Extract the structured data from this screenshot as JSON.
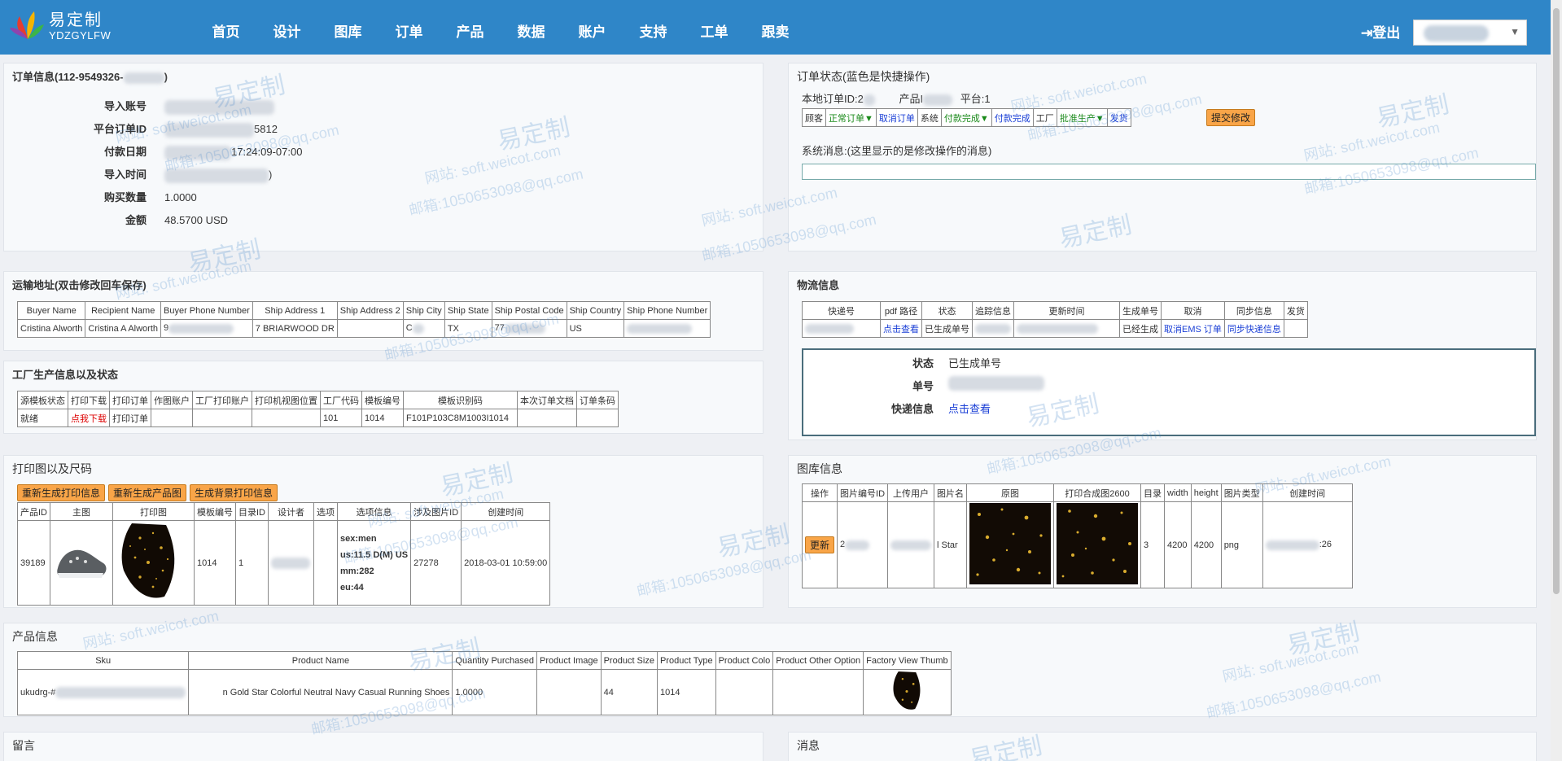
{
  "brand": {
    "name_cn": "易定制",
    "name_en": "YDZGYLFW",
    "colors": {
      "nav": "#2f86c8",
      "accent_button": "#f9a548",
      "link": "#1a3fd6"
    }
  },
  "nav": {
    "items": [
      "首页",
      "设计",
      "图库",
      "订单",
      "产品",
      "数据",
      "账户",
      "支持",
      "工单",
      "跟卖"
    ],
    "logout": "登出",
    "logout_icon": "logout-icon"
  },
  "order_info": {
    "title": "订单信息(112-9549326-",
    "title_end": ")",
    "rows": [
      {
        "k": "导入账号",
        "v": ""
      },
      {
        "k": "平台订单ID",
        "v": "5812"
      },
      {
        "k": "付款日期",
        "v": "17:24:09-07:00"
      },
      {
        "k": "导入时间",
        "v": ")"
      },
      {
        "k": "购买数量",
        "v": "1.0000"
      },
      {
        "k": "金额",
        "v": "48.5700  USD"
      }
    ]
  },
  "order_status": {
    "title": "订单状态(蓝色是快捷操作)",
    "local_id_label": "本地订单ID:2",
    "product_label": "产品I",
    "platform_label": "平台:1",
    "customer": "顾客",
    "customer_status": "正常订单▼",
    "cancel": "取消订单",
    "system": "系统",
    "pay_status": "付款完成▼",
    "pay_link": "付款完成",
    "factory": "工厂",
    "factory_status": "批准生产▼",
    "ship": "发货",
    "submit": "提交修改",
    "sys_msg": "系统消息:(这里显示的是修改操作的消息)"
  },
  "shipping": {
    "title": "运输地址(双击修改回车保存)",
    "headers": [
      "Buyer Name",
      "Recipient Name",
      "Buyer Phone Number",
      "Ship Address 1",
      "Ship Address 2",
      "Ship City",
      "Ship State",
      "Ship Postal Code",
      "Ship Country",
      "Ship Phone Number"
    ],
    "row": [
      "Cristina Alworth",
      "Cristina A Alworth",
      "9",
      "7 BRIARWOOD DR",
      "",
      "C",
      "TX",
      "77",
      "US",
      ""
    ]
  },
  "logistics": {
    "title": "物流信息",
    "headers": [
      "快递号",
      "pdf 路径",
      "状态",
      "追踪信息",
      "更新时间",
      "生成单号",
      "取消",
      "同步信息",
      "发货"
    ],
    "row": [
      "",
      "点击查看",
      "已生成单号",
      "",
      "",
      "已经生成",
      "取消EMS 订单",
      "同步快递信息",
      ""
    ],
    "status_label": "状态",
    "status_value": "已生成单号",
    "number_label": "单号",
    "express_label": "快递信息",
    "express_link": "点击查看"
  },
  "factory": {
    "title": "工厂生产信息以及状态",
    "headers": [
      "源模板状态",
      "打印下载",
      "打印订单",
      "作图账户",
      "工厂打印账户",
      "打印机视图位置",
      "工厂代码",
      "模板编号",
      "模板识别码",
      "本次订单文档",
      "订单条码"
    ],
    "row": [
      "就绪",
      "点我下载",
      "打印订单",
      "",
      "",
      "",
      "101",
      "1014",
      "F101P103C8M1003I1014",
      "",
      ""
    ]
  },
  "print": {
    "title": "打印图以及尺码",
    "buttons": [
      "重新生成打印信息",
      "重新生成产品图",
      "生成背景打印信息"
    ],
    "headers": [
      "产品ID",
      "主图",
      "打印图",
      "模板编号",
      "目录ID",
      "设计者",
      "选项",
      "选项信息",
      "涉及图片ID",
      "创建时间"
    ],
    "row": {
      "pid": "39189",
      "tpl": "1014",
      "cat": "1",
      "opts": [
        "sex:men",
        "us:11.5 D(M) US",
        "mm:282",
        "eu:44"
      ],
      "img_id": "27278",
      "created": "2018-03-01 10:59:00"
    }
  },
  "gallery": {
    "title": "图库信息",
    "headers": [
      "操作",
      "图片编号ID",
      "上传用户",
      "图片名",
      "原图",
      "打印合成图2600",
      "目录",
      "width",
      "height",
      "图片类型",
      "创建时间"
    ],
    "row": {
      "btn": "更新",
      "img_id": "2",
      "name": "l Star",
      "cat": "3",
      "w": "4200",
      "h": "4200",
      "type": "png",
      "created": ":26"
    }
  },
  "product": {
    "title": "产品信息",
    "headers": [
      "Sku",
      "Product Name",
      "Quantity Purchased",
      "Product Image",
      "Product Size",
      "Product Type",
      "Product Colo",
      "Product Other Option",
      "Factory View Thumb"
    ],
    "row": [
      "ukudrg-#",
      "n Gold Star Colorful Neutral Navy Casual Running Shoes",
      "1.0000",
      "",
      "44",
      "1014",
      "",
      ""
    ]
  },
  "footer": {
    "message_title": "留言",
    "news_title": "消息"
  },
  "watermark": {
    "brand": "易定制",
    "site": "网站: soft.weicot.com",
    "mail": "邮箱:1050653098@qq.com"
  }
}
